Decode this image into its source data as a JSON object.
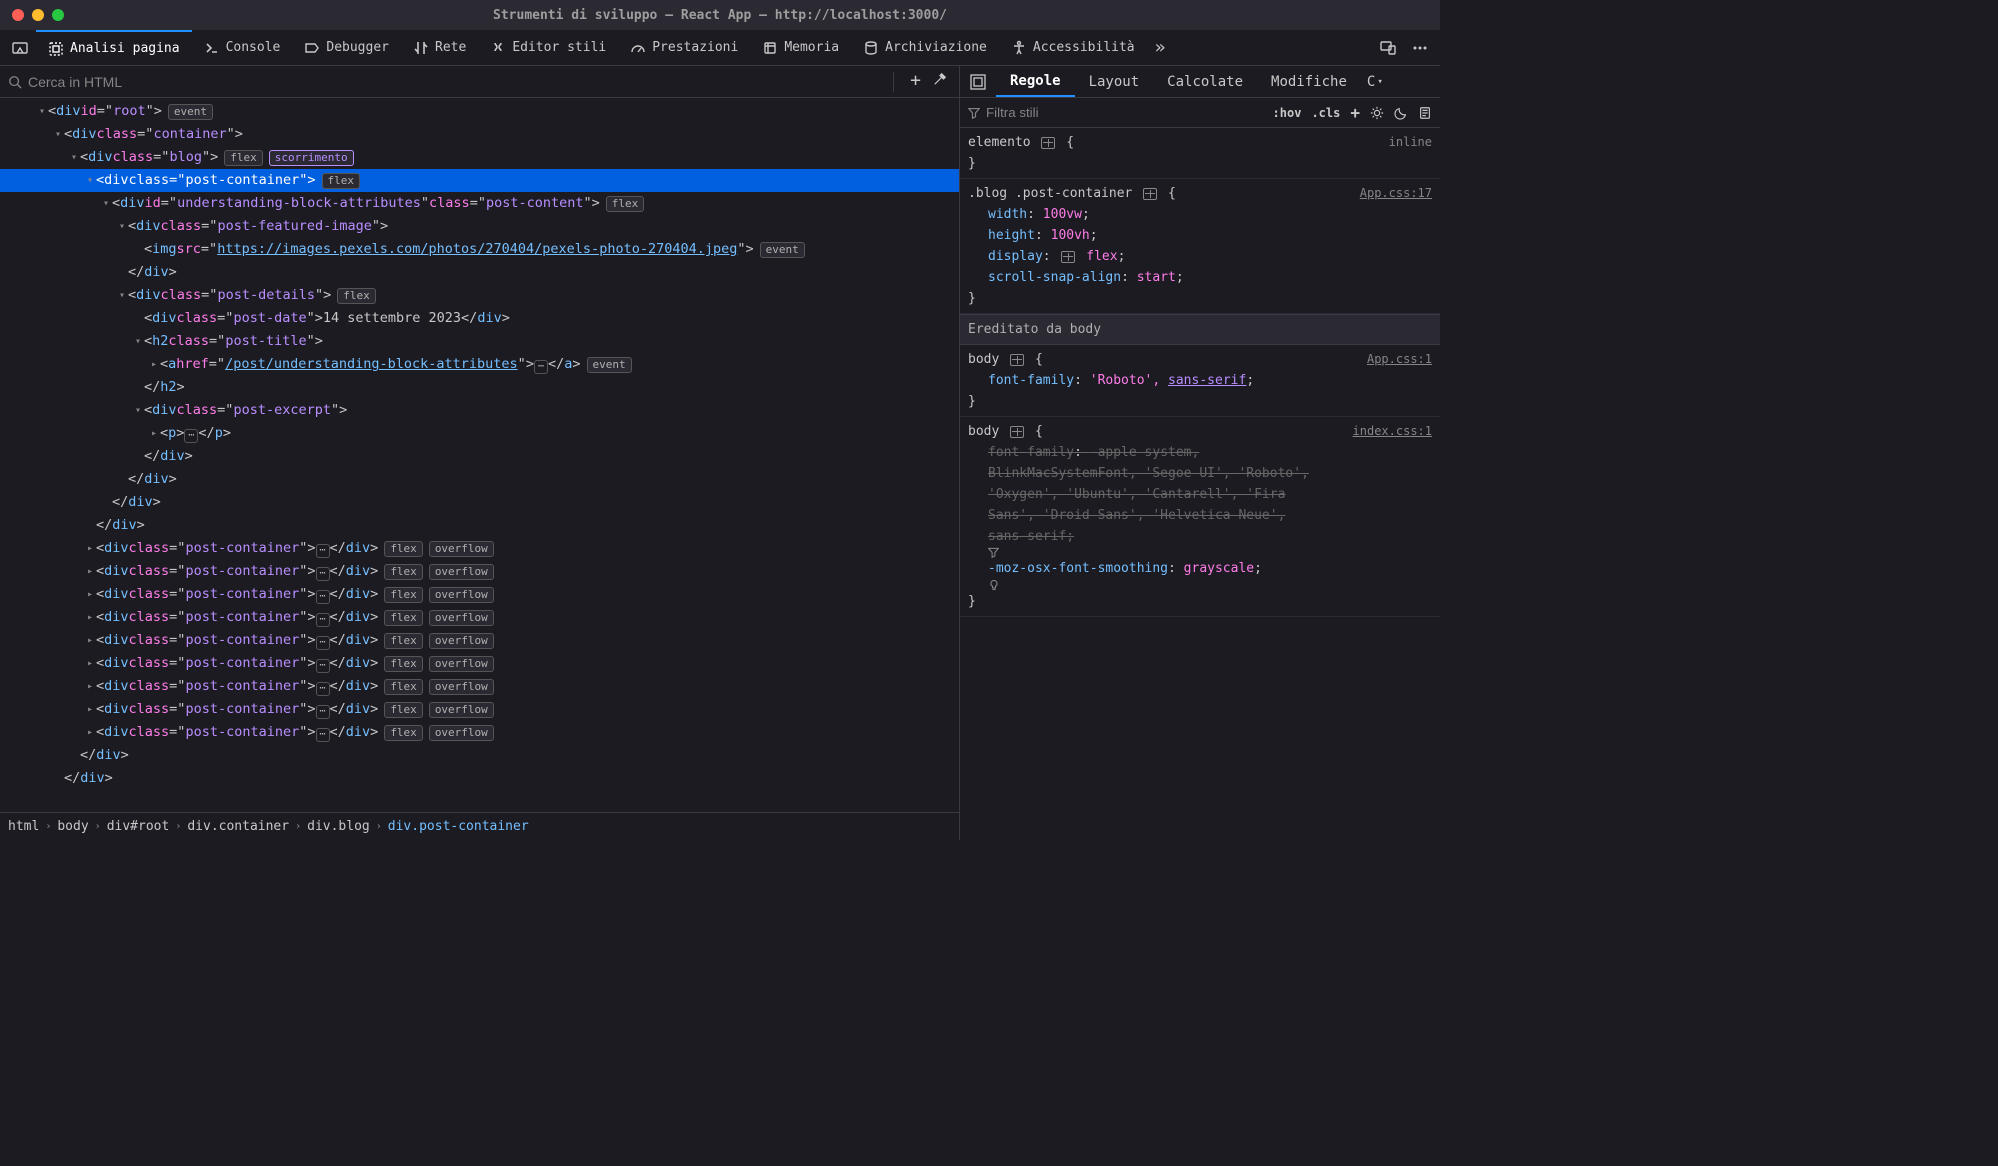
{
  "window": {
    "title": "Strumenti di sviluppo – React App – http://localhost:3000/"
  },
  "toolbar": {
    "tabs": [
      {
        "id": "inspector",
        "label": "Analisi pagina",
        "active": true
      },
      {
        "id": "console",
        "label": "Console"
      },
      {
        "id": "debugger",
        "label": "Debugger"
      },
      {
        "id": "network",
        "label": "Rete"
      },
      {
        "id": "styles",
        "label": "Editor stili"
      },
      {
        "id": "perf",
        "label": "Prestazioni"
      },
      {
        "id": "memory",
        "label": "Memoria"
      },
      {
        "id": "storage",
        "label": "Archiviazione"
      },
      {
        "id": "a11y",
        "label": "Accessibilità"
      }
    ],
    "overflow": "»"
  },
  "search": {
    "placeholder": "Cerca in HTML"
  },
  "dom": {
    "rows": [
      {
        "indent": 2,
        "twisty": "open",
        "html": "<div id=\"root\">",
        "badges": [
          "event"
        ]
      },
      {
        "indent": 3,
        "twisty": "open",
        "html": "<div class=\"container\">"
      },
      {
        "indent": 4,
        "twisty": "open",
        "html": "<div class=\"blog\">",
        "badges": [
          "flex",
          "scorrimento"
        ],
        "badgeStyles": [
          null,
          "purple"
        ]
      },
      {
        "indent": 5,
        "twisty": "open",
        "selected": true,
        "html": "<div class=\"post-container\">",
        "badges": [
          "flex"
        ]
      },
      {
        "indent": 6,
        "twisty": "open",
        "html": "<div id=\"understanding-block-attributes\" class=\"post-content\">",
        "badges": [
          "flex"
        ]
      },
      {
        "indent": 7,
        "twisty": "open",
        "html": "<div class=\"post-featured-image\">"
      },
      {
        "indent": 8,
        "twisty": "",
        "html": "<img src=\"LINK:https://images.pexels.com/photos/270404/pexels-photo-270404.jpeg\">",
        "badges": [
          "event"
        ]
      },
      {
        "indent": 7,
        "twisty": "",
        "html": "</div>"
      },
      {
        "indent": 7,
        "twisty": "open",
        "html": "<div class=\"post-details\">",
        "badges": [
          "flex"
        ]
      },
      {
        "indent": 8,
        "twisty": "",
        "html": "<div class=\"post-date\">TEXT:14 settembre 2023</div>"
      },
      {
        "indent": 8,
        "twisty": "open",
        "html": "<h2 class=\"post-title\">"
      },
      {
        "indent": 9,
        "twisty": "closed",
        "html": "<a href=\"LINK:/post/understanding-block-attributes\">ELLIPSIS</a>",
        "badges": [
          "event"
        ]
      },
      {
        "indent": 8,
        "twisty": "",
        "html": "</h2>"
      },
      {
        "indent": 8,
        "twisty": "open",
        "html": "<div class=\"post-excerpt\">"
      },
      {
        "indent": 9,
        "twisty": "closed",
        "html": "<p>ELLIPSIS</p>"
      },
      {
        "indent": 8,
        "twisty": "",
        "html": "</div>"
      },
      {
        "indent": 7,
        "twisty": "",
        "html": "</div>"
      },
      {
        "indent": 6,
        "twisty": "",
        "html": "</div>"
      },
      {
        "indent": 5,
        "twisty": "",
        "html": "</div>"
      },
      {
        "indent": 5,
        "twisty": "closed",
        "html": "<div class=\"post-container\">ELLIPSIS</div>",
        "badges": [
          "flex",
          "overflow"
        ]
      },
      {
        "indent": 5,
        "twisty": "closed",
        "html": "<div class=\"post-container\">ELLIPSIS</div>",
        "badges": [
          "flex",
          "overflow"
        ]
      },
      {
        "indent": 5,
        "twisty": "closed",
        "html": "<div class=\"post-container\">ELLIPSIS</div>",
        "badges": [
          "flex",
          "overflow"
        ]
      },
      {
        "indent": 5,
        "twisty": "closed",
        "html": "<div class=\"post-container\">ELLIPSIS</div>",
        "badges": [
          "flex",
          "overflow"
        ]
      },
      {
        "indent": 5,
        "twisty": "closed",
        "html": "<div class=\"post-container\">ELLIPSIS</div>",
        "badges": [
          "flex",
          "overflow"
        ]
      },
      {
        "indent": 5,
        "twisty": "closed",
        "html": "<div class=\"post-container\">ELLIPSIS</div>",
        "badges": [
          "flex",
          "overflow"
        ]
      },
      {
        "indent": 5,
        "twisty": "closed",
        "html": "<div class=\"post-container\">ELLIPSIS</div>",
        "badges": [
          "flex",
          "overflow"
        ]
      },
      {
        "indent": 5,
        "twisty": "closed",
        "html": "<div class=\"post-container\">ELLIPSIS</div>",
        "badges": [
          "flex",
          "overflow"
        ]
      },
      {
        "indent": 5,
        "twisty": "closed",
        "html": "<div class=\"post-container\">ELLIPSIS</div>",
        "badges": [
          "flex",
          "overflow"
        ]
      },
      {
        "indent": 4,
        "twisty": "",
        "html": "</div>"
      },
      {
        "indent": 3,
        "twisty": "",
        "html": "</div>"
      }
    ]
  },
  "breadcrumbs": [
    "html",
    "body",
    "div#root",
    "div.container",
    "div.blog",
    "div.post-container"
  ],
  "styles": {
    "tabs": [
      "Regole",
      "Layout",
      "Calcolate",
      "Modifiche"
    ],
    "activeTab": 0,
    "overflow": "C",
    "filterPlaceholder": "Filtra stili",
    "hov": ":hov",
    "cls": ".cls",
    "rules": [
      {
        "selector": "elemento",
        "gridIcon": true,
        "brace": "{",
        "source": "inline",
        "sourceClass": "inline",
        "decls": [],
        "close": "}"
      },
      {
        "selector": ".blog .post-container",
        "gridIcon": true,
        "brace": "{",
        "source": "App.css:17",
        "decls": [
          {
            "prop": "width",
            "val": "100vw"
          },
          {
            "prop": "height",
            "val": "100vh"
          },
          {
            "prop": "display",
            "valPrefixIcon": true,
            "val": "flex"
          },
          {
            "prop": "scroll-snap-align",
            "val": "start"
          }
        ],
        "close": "}"
      },
      {
        "inherited": "Ereditato da body"
      },
      {
        "selector": "body",
        "gridIcon": true,
        "brace": "{",
        "source": "App.css:1",
        "decls": [
          {
            "prop": "font-family",
            "valParts": [
              {
                "t": "str",
                "v": "'Roboto'"
              },
              {
                "t": "plain",
                "v": ", "
              },
              {
                "t": "link",
                "v": "sans-serif"
              }
            ]
          }
        ],
        "close": "}"
      },
      {
        "selector": "body",
        "gridIcon": true,
        "brace": "{",
        "source": "index.css:1",
        "decls": [
          {
            "struck": true,
            "prop": "font-family",
            "valParts": [
              {
                "t": "plain",
                "v": "-apple-system, "
              }
            ]
          },
          {
            "struck": true,
            "continuation": true,
            "valParts": [
              {
                "t": "plain",
                "v": "BlinkMacSystemFont, 'Segoe UI', 'Roboto',"
              }
            ]
          },
          {
            "struck": true,
            "continuation": true,
            "valParts": [
              {
                "t": "plain",
                "v": "'Oxygen', 'Ubuntu', 'Cantarell', 'Fira"
              }
            ]
          },
          {
            "struck": true,
            "continuation": true,
            "valParts": [
              {
                "t": "plain",
                "v": "Sans', 'Droid Sans', 'Helvetica Neue',"
              }
            ]
          },
          {
            "struck": true,
            "continuation": true,
            "trailingIcon": "filter",
            "valParts": [
              {
                "t": "plain",
                "v": "sans-serif;"
              }
            ]
          },
          {
            "prop": "-moz-osx-font-smoothing",
            "val": "grayscale",
            "trailingIcon": "bulb"
          }
        ],
        "close": "}"
      }
    ]
  }
}
